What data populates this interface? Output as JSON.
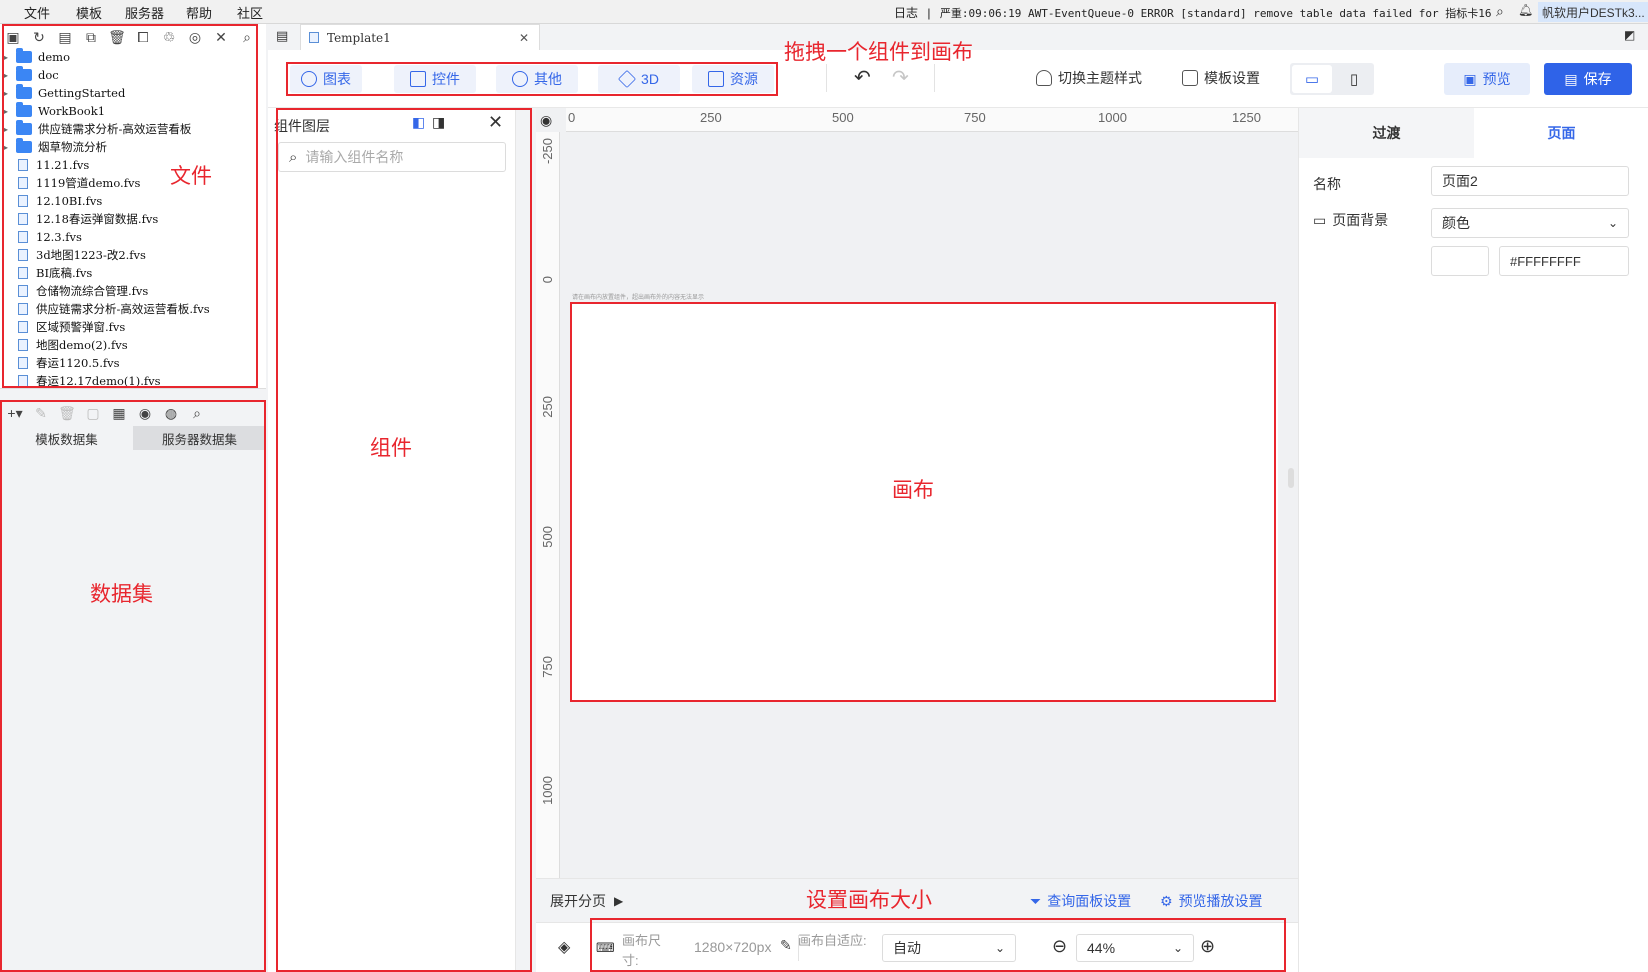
{
  "menubar": {
    "items": [
      "文件",
      "模板",
      "服务器",
      "帮助",
      "社区"
    ],
    "log_label": "日志",
    "log_message": "严重:09:06:19 AWT-EventQueue-0 ERROR [standard] remove table data failed for 指标卡16",
    "user": "帆软用户DESTk3..."
  },
  "file_tree": {
    "items": [
      {
        "type": "folder",
        "name": "demo"
      },
      {
        "type": "folder",
        "name": "doc"
      },
      {
        "type": "folder",
        "name": "GettingStarted"
      },
      {
        "type": "folder",
        "name": "WorkBook1"
      },
      {
        "type": "folder",
        "name": "供应链需求分析-高效运营看板"
      },
      {
        "type": "folder",
        "name": "烟草物流分析"
      },
      {
        "type": "file",
        "name": "11.21.fvs"
      },
      {
        "type": "file",
        "name": "1119管道demo.fvs"
      },
      {
        "type": "file",
        "name": "12.10BI.fvs"
      },
      {
        "type": "file",
        "name": "12.18春运弹窗数据.fvs"
      },
      {
        "type": "file",
        "name": "12.3.fvs"
      },
      {
        "type": "file",
        "name": "3d地图1223-改2.fvs"
      },
      {
        "type": "file",
        "name": "BI底稿.fvs"
      },
      {
        "type": "file",
        "name": "仓储物流综合管理.fvs"
      },
      {
        "type": "file",
        "name": "供应链需求分析-高效运营看板.fvs"
      },
      {
        "type": "file",
        "name": "区域预警弹窗.fvs"
      },
      {
        "type": "file",
        "name": "地图demo(2).fvs"
      },
      {
        "type": "file",
        "name": "春运1120.5.fvs"
      },
      {
        "type": "file",
        "name": "春运12.17demo(1).fvs"
      }
    ]
  },
  "dataset": {
    "tabs": [
      "模板数据集",
      "服务器数据集"
    ]
  },
  "tab": {
    "title": "Template1"
  },
  "component_toolbar": {
    "buttons": [
      "图表",
      "控件",
      "其他",
      "3D",
      "资源"
    ],
    "theme": "切换主题样式",
    "template_settings": "模板设置",
    "preview": "预览",
    "save": "保存"
  },
  "layer_panel": {
    "title": "组件图层",
    "search_placeholder": "请输入组件名称"
  },
  "canvas": {
    "ruler_top": [
      "0",
      "250",
      "500",
      "750",
      "1000",
      "1250"
    ],
    "ruler_left": [
      "-250",
      "0",
      "250",
      "500",
      "750",
      "1000"
    ],
    "hint": "请在画布内放置组件，超出画布外的内容无法显示"
  },
  "page_bar": {
    "expand": "展开分页",
    "query_settings": "查询面板设置",
    "playback_settings": "预览播放设置"
  },
  "size_bar": {
    "size_label": "画布尺寸:",
    "size_value": "1280×720px",
    "fit_label": "画布自适应:",
    "fit_value": "自动",
    "zoom_value": "44%"
  },
  "right_panel": {
    "tabs": [
      "过渡",
      "页面"
    ],
    "name_label": "名称",
    "name_value": "页面2",
    "bg_label": "页面背景",
    "bg_type": "颜色",
    "bg_color": "#FFFFFFFF"
  },
  "annotations": {
    "files": "文件",
    "dataset": "数据集",
    "components": "组件",
    "drag_hint": "拖拽一个组件到画布",
    "canvas": "画布",
    "canvas_size": "设置画布大小"
  },
  "colors": {
    "accent": "#3567e8",
    "annotation": "#e8262e"
  }
}
